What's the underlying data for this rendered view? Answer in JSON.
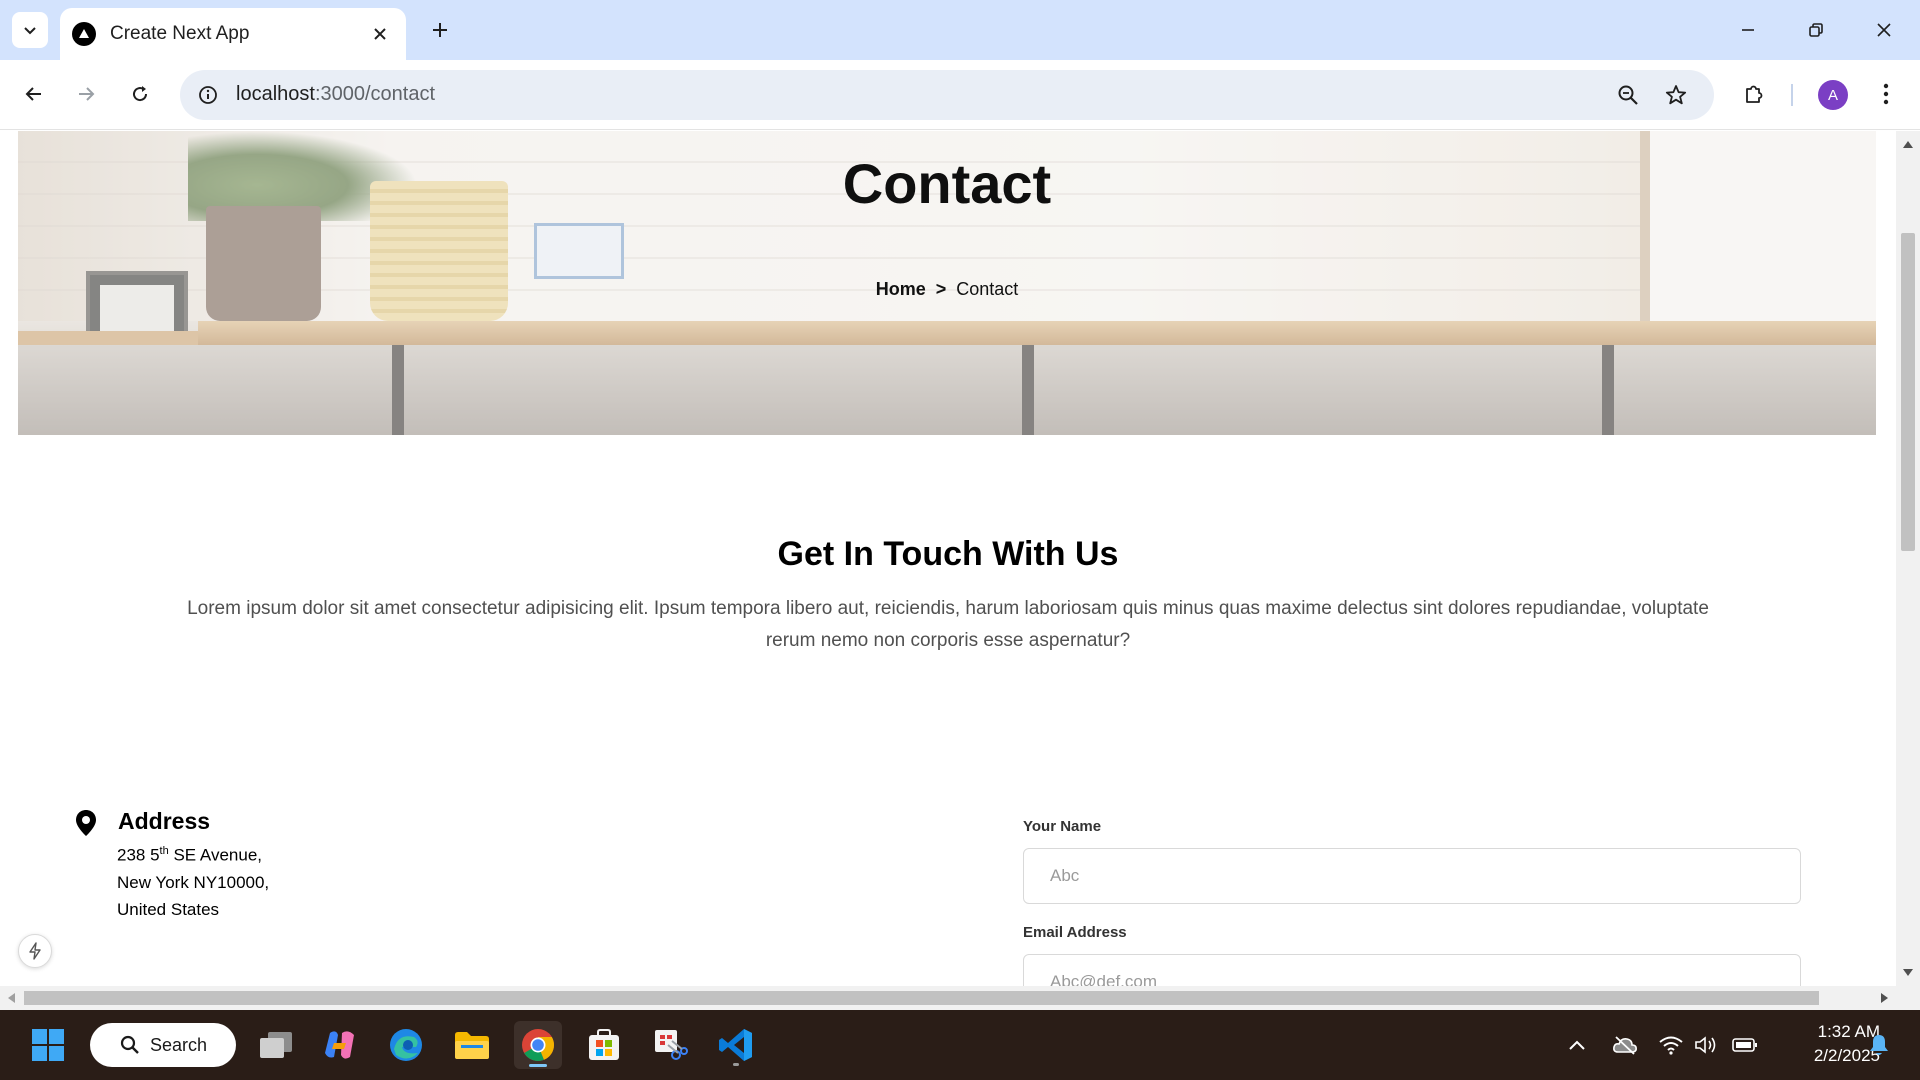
{
  "browser": {
    "tab_title": "Create Next App",
    "url_host": "localhost",
    "url_rest": ":3000/contact",
    "profile_initial": "A"
  },
  "hero": {
    "title": "Contact",
    "breadcrumb_home": "Home",
    "breadcrumb_separator": ">",
    "breadcrumb_current": "Contact"
  },
  "intro": {
    "title": "Get In Touch With Us",
    "description": "Lorem ipsum dolor sit amet consectetur adipisicing elit. Ipsum tempora libero aut, reiciendis, harum laboriosam quis minus quas maxime delectus sint dolores repudiandae, voluptate rerum nemo non corporis esse aspernatur?"
  },
  "address": {
    "icon": "map-pin-icon",
    "title": "Address",
    "line1_prefix": "238 5",
    "line1_sup": "th",
    "line1_suffix": " SE Avenue,",
    "line2": "New York NY10000,",
    "line3": "United States"
  },
  "form": {
    "name_label": "Your Name",
    "name_placeholder": "Abc",
    "email_label": "Email Address",
    "email_placeholder": "Abc@def.com"
  },
  "taskbar": {
    "search_label": "Search",
    "time": "1:32 AM",
    "date": "2/2/2025"
  },
  "colors": {
    "tabstrip_bg": "#d3e3fd",
    "omnibox_bg": "#e9eef6",
    "avatar_bg": "#7b3fc4",
    "taskbar_bg": "#2a1d17"
  }
}
